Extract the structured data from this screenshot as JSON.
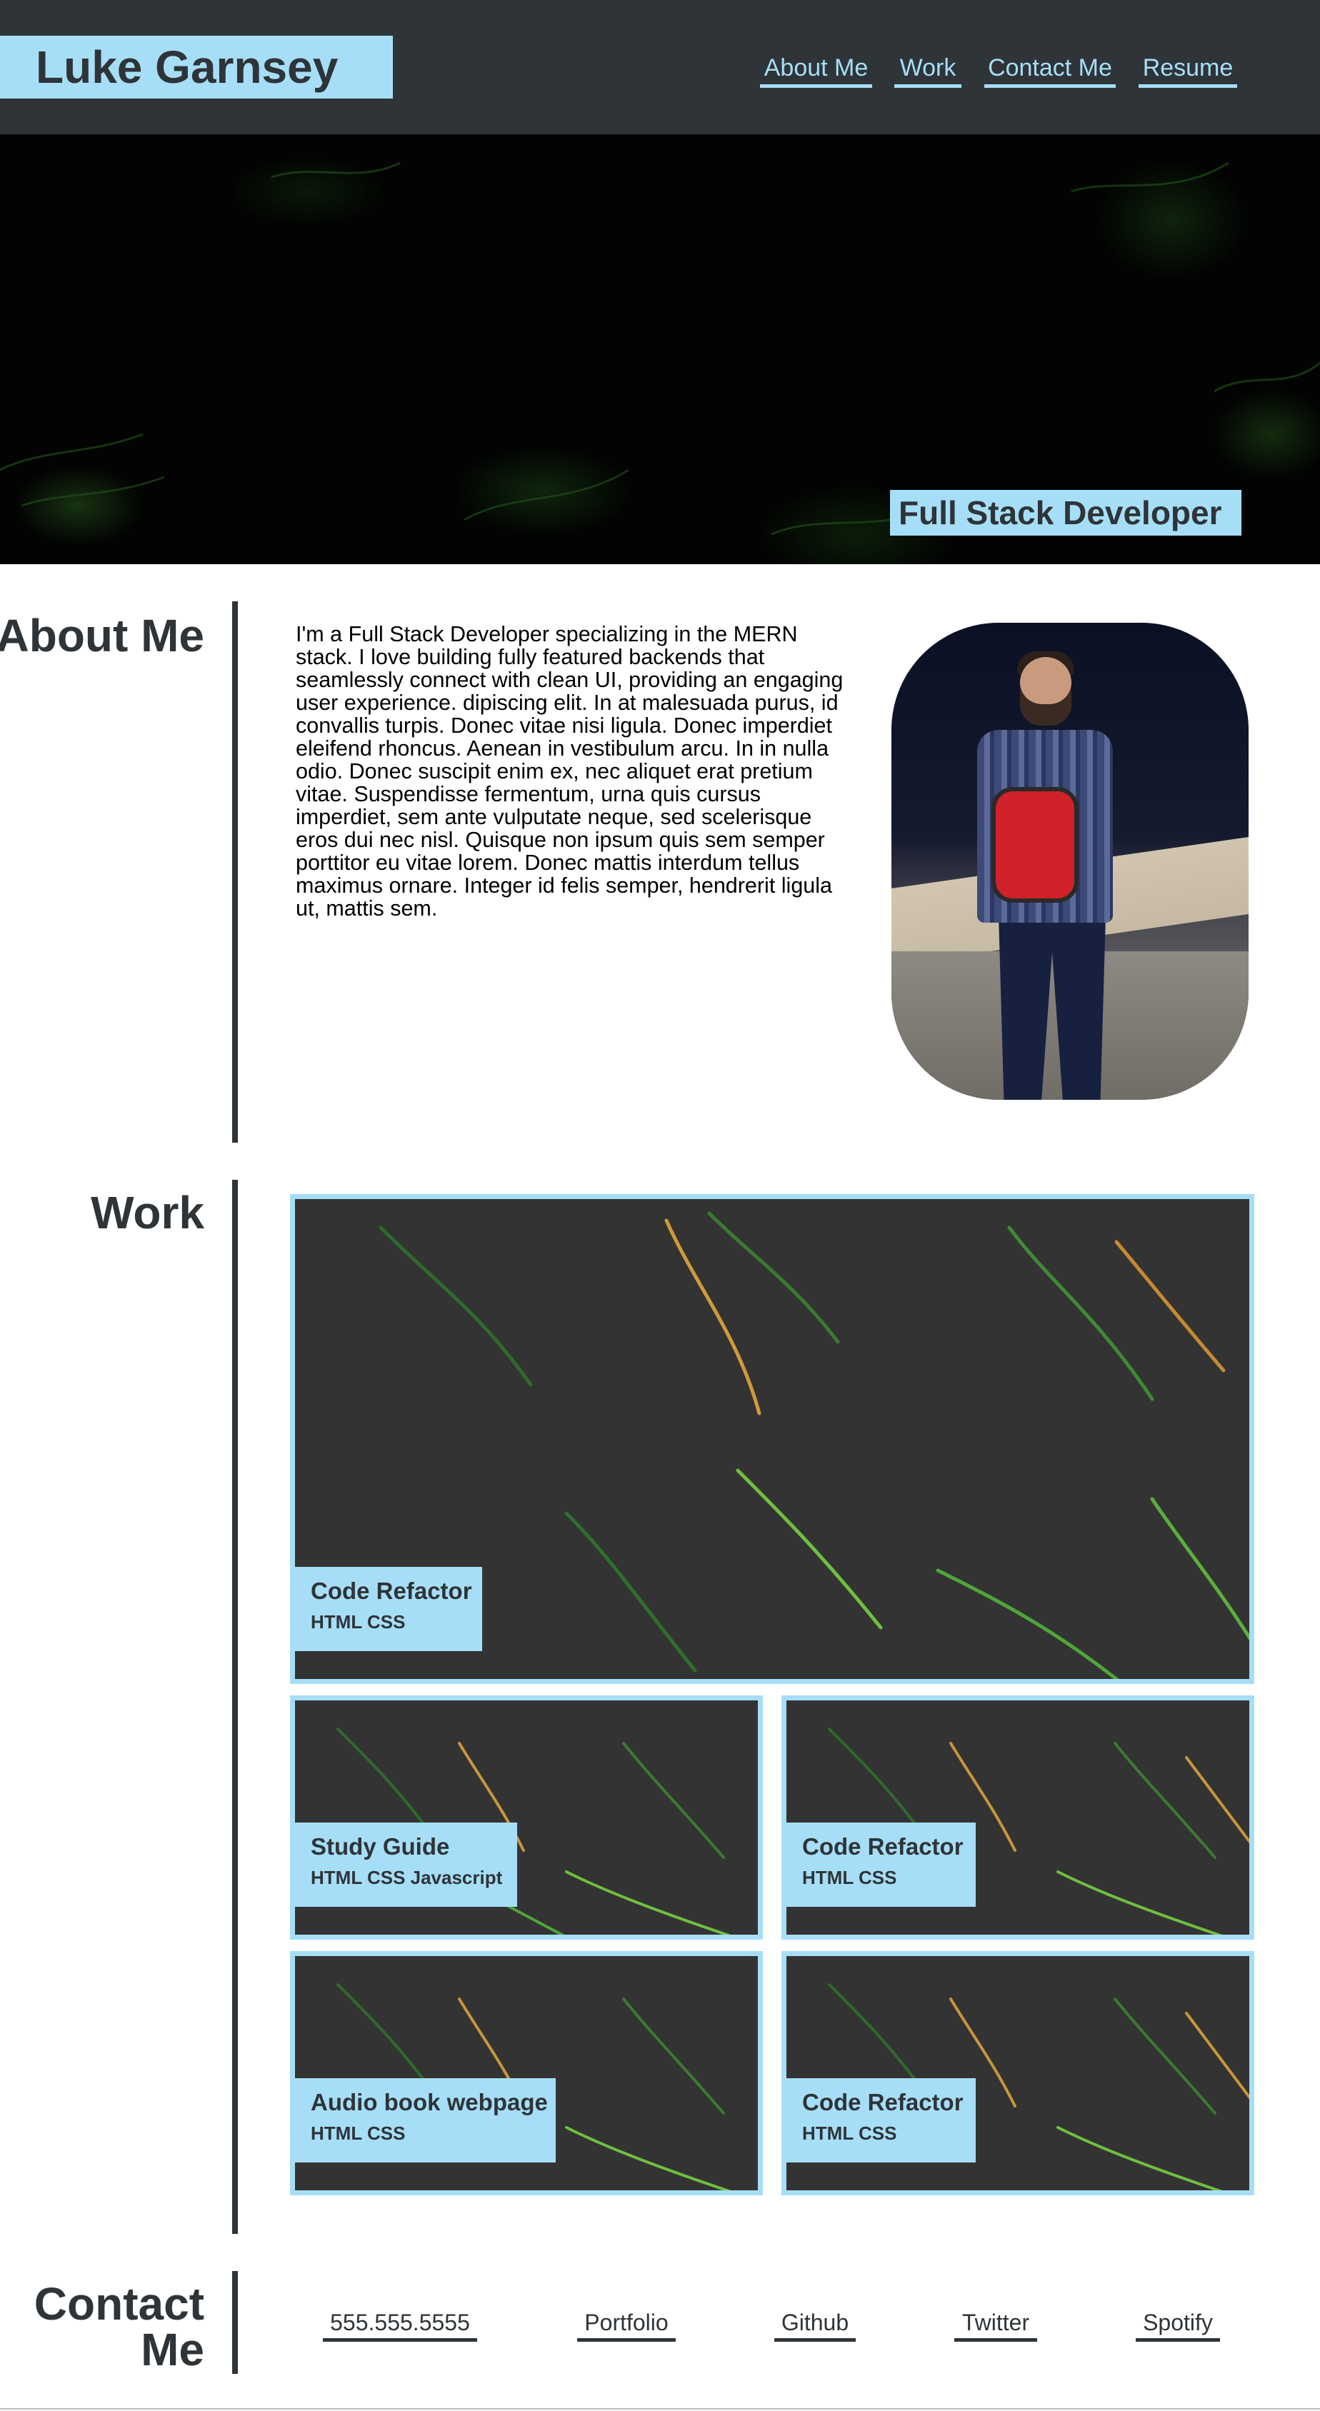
{
  "header": {
    "brand": "Luke Garnsey",
    "nav": [
      {
        "label": "About Me"
      },
      {
        "label": "Work"
      },
      {
        "label": "Contact Me"
      },
      {
        "label": "Resume"
      }
    ]
  },
  "hero": {
    "title": "Full Stack Developer"
  },
  "about": {
    "heading": "About Me",
    "text": "I'm a Full Stack Developer specializing in the MERN stack. I love building fully featured backends that seamlessly connect with clean UI, providing an engaging user experience. dipiscing elit. In at malesuada purus, id convallis turpis. Donec vitae nisi ligula. Donec imperdiet eleifend rhoncus. Aenean in vestibulum arcu. In in nulla odio. Donec suscipit enim ex, nec aliquet erat pretium vitae. Suspendisse fermentum, urna quis cursus imperdiet, sem ante vulputate neque, sed scelerisque eros dui nec nisl. Quisque non ipsum quis sem semper porttitor eu vitae lorem. Donec mattis interdum tellus maximus ornare. Integer id felis semper, hendrerit ligula ut, mattis sem."
  },
  "work": {
    "heading": "Work",
    "projects": [
      {
        "title": "Code Refactor",
        "tags": "HTML CSS"
      },
      {
        "title": "Study Guide",
        "tags": "HTML CSS Javascript"
      },
      {
        "title": "Code Refactor",
        "tags": "HTML CSS"
      },
      {
        "title": "Audio book webpage",
        "tags": "HTML CSS"
      },
      {
        "title": "Code Refactor",
        "tags": "HTML CSS"
      }
    ]
  },
  "contact": {
    "heading": "Contact Me",
    "links": [
      {
        "label": "555.555.5555"
      },
      {
        "label": "Portfolio"
      },
      {
        "label": "Github"
      },
      {
        "label": "Twitter"
      },
      {
        "label": "Spotify"
      }
    ]
  },
  "colors": {
    "accent": "#a7def7",
    "dark": "#2e3438"
  }
}
